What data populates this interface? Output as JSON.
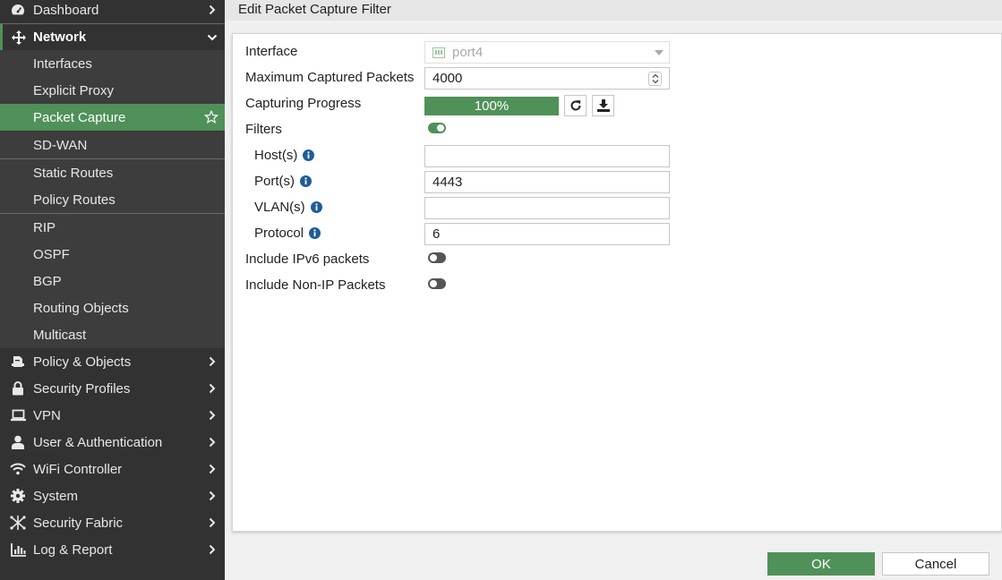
{
  "sidebar": {
    "items": [
      {
        "label": "Dashboard",
        "icon": "dashboard-icon"
      },
      {
        "label": "Network",
        "icon": "network-move-icon"
      },
      {
        "label": "Interfaces"
      },
      {
        "label": "Explicit Proxy"
      },
      {
        "label": "Packet Capture",
        "icon": "star-icon"
      },
      {
        "label": "SD-WAN"
      },
      {
        "label": "Static Routes"
      },
      {
        "label": "Policy Routes"
      },
      {
        "label": "RIP"
      },
      {
        "label": "OSPF"
      },
      {
        "label": "BGP"
      },
      {
        "label": "Routing Objects"
      },
      {
        "label": "Multicast"
      },
      {
        "label": "Policy & Objects",
        "icon": "policy-icon"
      },
      {
        "label": "Security Profiles",
        "icon": "lock-icon"
      },
      {
        "label": "VPN",
        "icon": "laptop-icon"
      },
      {
        "label": "User & Authentication",
        "icon": "user-icon"
      },
      {
        "label": "WiFi Controller",
        "icon": "wifi-icon"
      },
      {
        "label": "System",
        "icon": "gear-icon"
      },
      {
        "label": "Security Fabric",
        "icon": "fabric-icon"
      },
      {
        "label": "Log & Report",
        "icon": "chart-icon"
      }
    ]
  },
  "header": {
    "title": "Edit Packet Capture Filter"
  },
  "form": {
    "interface_label": "Interface",
    "interface_value": "port4",
    "max_packets_label": "Maximum Captured Packets",
    "max_packets_value": "4000",
    "progress_label": "Capturing Progress",
    "progress_text": "100%",
    "progress_value": 1.0,
    "filters_label": "Filters",
    "filters_enabled": true,
    "hosts_label": "Host(s)",
    "hosts_value": "",
    "ports_label": "Port(s)",
    "ports_value": "4443",
    "vlans_label": "VLAN(s)",
    "vlans_value": "",
    "protocol_label": "Protocol",
    "protocol_value": "6",
    "ipv6_label": "Include IPv6 packets",
    "ipv6_enabled": false,
    "nonip_label": "Include Non-IP Packets",
    "nonip_enabled": false
  },
  "footer": {
    "ok_label": "OK",
    "cancel_label": "Cancel"
  },
  "colors": {
    "accent": "#4f9159",
    "sidebar_bg": "#323232",
    "info_blue": "#1f5c99"
  }
}
